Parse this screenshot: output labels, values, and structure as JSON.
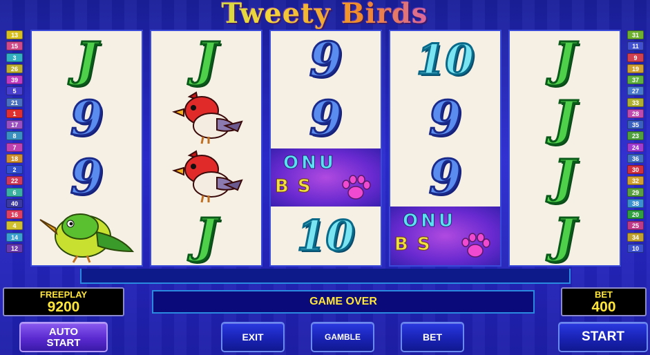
{
  "title": "Tweety Birds",
  "left_lines": [
    {
      "n": "13",
      "c": "#d8c020"
    },
    {
      "n": "15",
      "c": "#d04a8a"
    },
    {
      "n": "3",
      "c": "#30b0c0"
    },
    {
      "n": "26",
      "c": "#c0b030"
    },
    {
      "n": "39",
      "c": "#c03ac0"
    },
    {
      "n": "5",
      "c": "#4a40d0"
    },
    {
      "n": "21",
      "c": "#4a70c0"
    },
    {
      "n": "1",
      "c": "#e03030"
    },
    {
      "n": "17",
      "c": "#9a50c0"
    },
    {
      "n": "8",
      "c": "#3a90c0"
    },
    {
      "n": "7",
      "c": "#c040b0"
    },
    {
      "n": "18",
      "c": "#d09030"
    },
    {
      "n": "2",
      "c": "#3050d0"
    },
    {
      "n": "22",
      "c": "#d03a5a"
    },
    {
      "n": "6",
      "c": "#3ab0a0"
    },
    {
      "n": "40",
      "c": "#3a3aa0"
    },
    {
      "n": "16",
      "c": "#e04060"
    },
    {
      "n": "4",
      "c": "#d0c030"
    },
    {
      "n": "14",
      "c": "#3aa0d0"
    },
    {
      "n": "12",
      "c": "#6a3ab0"
    }
  ],
  "right_lines": [
    {
      "n": "31",
      "c": "#70b030"
    },
    {
      "n": "11",
      "c": "#4050d0"
    },
    {
      "n": "9",
      "c": "#d04050"
    },
    {
      "n": "19",
      "c": "#d0a030"
    },
    {
      "n": "37",
      "c": "#60b040"
    },
    {
      "n": "27",
      "c": "#4a7ad0"
    },
    {
      "n": "33",
      "c": "#b0b030"
    },
    {
      "n": "28",
      "c": "#c04ab0"
    },
    {
      "n": "35",
      "c": "#3a60c0"
    },
    {
      "n": "23",
      "c": "#50a040"
    },
    {
      "n": "24",
      "c": "#a03ad0"
    },
    {
      "n": "36",
      "c": "#4070c0"
    },
    {
      "n": "30",
      "c": "#d03040"
    },
    {
      "n": "32",
      "c": "#d0a030"
    },
    {
      "n": "29",
      "c": "#5aa040"
    },
    {
      "n": "38",
      "c": "#3a90d0"
    },
    {
      "n": "20",
      "c": "#30a040"
    },
    {
      "n": "25",
      "c": "#c03a8a"
    },
    {
      "n": "34",
      "c": "#c0a030"
    },
    {
      "n": "10",
      "c": "#3a50d0"
    }
  ],
  "reels": [
    [
      "J",
      "9",
      "9",
      "green-bird"
    ],
    [
      "J",
      "red-bird",
      "red-bird",
      "J"
    ],
    [
      "9",
      "9",
      "bonus",
      "10"
    ],
    [
      "10",
      "9",
      "9",
      "bonus"
    ],
    [
      "J",
      "J",
      "J",
      "J"
    ]
  ],
  "bonus_symbol": {
    "line1": "ONU",
    "line2": "B S"
  },
  "freeplay": {
    "label": "FREEPLAY",
    "value": "9200"
  },
  "bet": {
    "label": "BET",
    "value": "400"
  },
  "status": "GAME OVER",
  "buttons": {
    "auto_start": "AUTO\nSTART",
    "exit": "EXIT",
    "gamble": "GAMBLE",
    "bet": "BET",
    "start": "START"
  }
}
